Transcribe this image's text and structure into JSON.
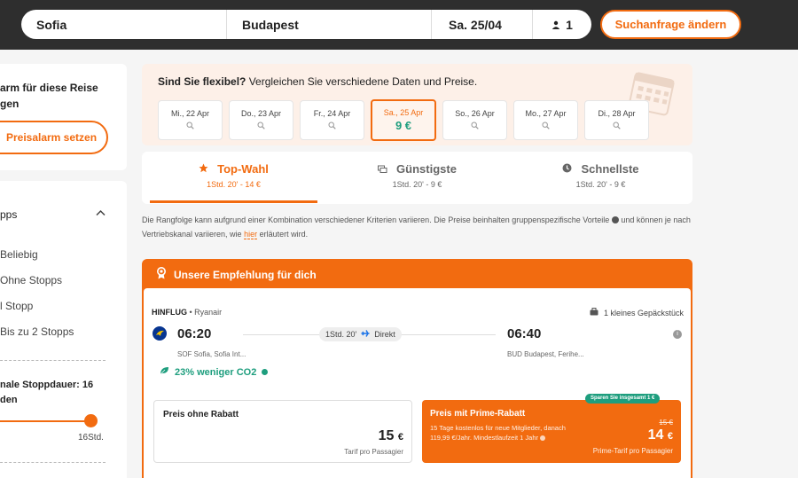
{
  "search": {
    "from": "Sofia",
    "to": "Budapest",
    "date": "Sa. 25/04",
    "passengers": "1",
    "change_button": "Suchanfrage ändern"
  },
  "sidebar": {
    "alarm_text_1": "arm für diese Reise",
    "alarm_text_2": "gen",
    "alarm_button": "Preisalarm setzen",
    "stops_title": "pps",
    "stop_options": [
      "Beliebig",
      "Ohne Stopps",
      "l Stopp",
      "Bis zu 2 Stopps"
    ],
    "duration_label_1": "nale Stoppdauer: 16",
    "duration_label_2": "den",
    "duration_value": "16Std.",
    "duration_level_fraction": 1.0
  },
  "flex": {
    "title_bold": "Sind Sie flexibel?",
    "title_rest": " Vergleichen Sie verschiedene Daten und Preise.",
    "dates": [
      {
        "label": "Mi., 22 Apr",
        "price": "",
        "selected": false
      },
      {
        "label": "Do., 23 Apr",
        "price": "",
        "selected": false
      },
      {
        "label": "Fr., 24 Apr",
        "price": "",
        "selected": false
      },
      {
        "label": "Sa., 25 Apr",
        "price": "9 €",
        "selected": true
      },
      {
        "label": "So., 26 Apr",
        "price": "",
        "selected": false
      },
      {
        "label": "Mo., 27 Apr",
        "price": "",
        "selected": false
      },
      {
        "label": "Di., 28 Apr",
        "price": "",
        "selected": false
      }
    ]
  },
  "tabs": [
    {
      "title": "Top-Wahl",
      "sub": "1Std. 20' - 14 €",
      "icon": "star-icon",
      "active": true
    },
    {
      "title": "Günstigste",
      "sub": "1Std. 20' - 9 €",
      "icon": "money-icon",
      "active": false
    },
    {
      "title": "Schnellste",
      "sub": "1Std. 20' - 9 €",
      "icon": "clock-icon",
      "active": false
    }
  ],
  "disclaimer": {
    "part1": "Die Rangfolge kann aufgrund einer Kombination verschiedener Kriterien variieren. Die Preise beinhalten gruppenspezifische Vorteile ",
    "part2": " und können je nach Vertriebskanal variieren, wie ",
    "link": "hier",
    "part3": " erläutert wird."
  },
  "recommendation": {
    "header": "Unsere Empfehlung für dich",
    "leg_label": "HINFLUG",
    "airline": " • Ryanair",
    "baggage": "1 kleines Gepäckstück",
    "depart_time": "06:20",
    "arrive_time": "06:40",
    "duration": "1Std. 20'",
    "direct": "Direkt",
    "depart_airport": "SOF Sofia, Sofia Int...",
    "arrive_airport": "BUD Budapest, Ferihe...",
    "co2": "23% weniger CO2",
    "standard": {
      "title": "Preis ohne Rabatt",
      "price": "15",
      "currency": "€",
      "sub": "Tarif pro Passagier"
    },
    "prime": {
      "badge": "Sparen Sie insgesamt 1 €",
      "title": "Preis mit Prime-Rabatt",
      "desc_1": "15 Tage kostenlos für neue Mitglieder, danach",
      "desc_2": "119,99 €/Jahr. Mindestlaufzeit 1 Jahr",
      "old_price": "15 €",
      "price": "14",
      "currency": "€",
      "sub": "Prime-Tarif pro Passagier"
    }
  }
}
